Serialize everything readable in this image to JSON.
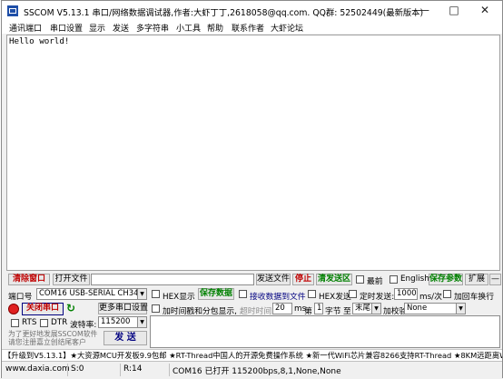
{
  "window": {
    "title": "SSCOM V5.13.1 串口/网络数据调试器,作者:大虾丁丁,2618058@qq.com. QQ群: 52502449(最新版本)",
    "min_glyph": "—",
    "max_glyph": "□",
    "close_glyph": "✕"
  },
  "menu": [
    "通讯端口",
    "串口设置",
    "显示",
    "发送",
    "多字符串",
    "小工具",
    "帮助",
    "联系作者",
    "大虾论坛"
  ],
  "receive": {
    "text": "Hello world!"
  },
  "row1": {
    "clear_window": "清除窗口",
    "open_file": "打开文件",
    "send_file": "发送文件",
    "stop": "停止",
    "clear_send_area": "清发送区",
    "front": "最前",
    "english": "English",
    "save_params": "保存参数",
    "expand": "扩展",
    "dash": "—"
  },
  "port": {
    "label": "端口号",
    "value": "COM16 USB-SERIAL CH340",
    "close_port": "关闭串口",
    "more_settings": "更多串口设置",
    "rts": "RTS",
    "dtr": "DTR",
    "baud_label": "波特率:",
    "baud_value": "115200"
  },
  "options": {
    "hex_display": "HEX显示",
    "save_data": "保存数据",
    "recv_to_file": "接收数据到文件",
    "hex_send": "HEX发送",
    "timed_send": "定时发送:",
    "interval": "1000",
    "interval_unit": "ms/次",
    "add_crlf": "加回车换行",
    "timestamp_packet": "加时间戳和分包显示,",
    "timeout_label": "超时时间:",
    "timeout": "20",
    "timeout_unit": "ms",
    "nth": "第",
    "byte_index": "1",
    "byte_unit": "字节",
    "to": "至",
    "to_value": "末尾",
    "checksum_label": "加校验",
    "checksum_value": "None"
  },
  "send": {
    "label": "发 送"
  },
  "promo": {
    "line1": "为了更好地发展SSCOM软件",
    "line2": "请您注册嘉立创结尾客户"
  },
  "footer": {
    "text": "【升级到V5.13.1】★大资源MCU开发板9.9包邮 ★RT-Thread中国人的开源免费操作系统 ★新一代WiFi芯片兼容8266支持RT-Thread ★8KM远距离WiFi可自组网"
  },
  "status": {
    "site": "www.daxia.com",
    "sent": "S:0",
    "received": "R:14",
    "port_state": "COM16 已打开  115200bps,8,1,None,None"
  }
}
